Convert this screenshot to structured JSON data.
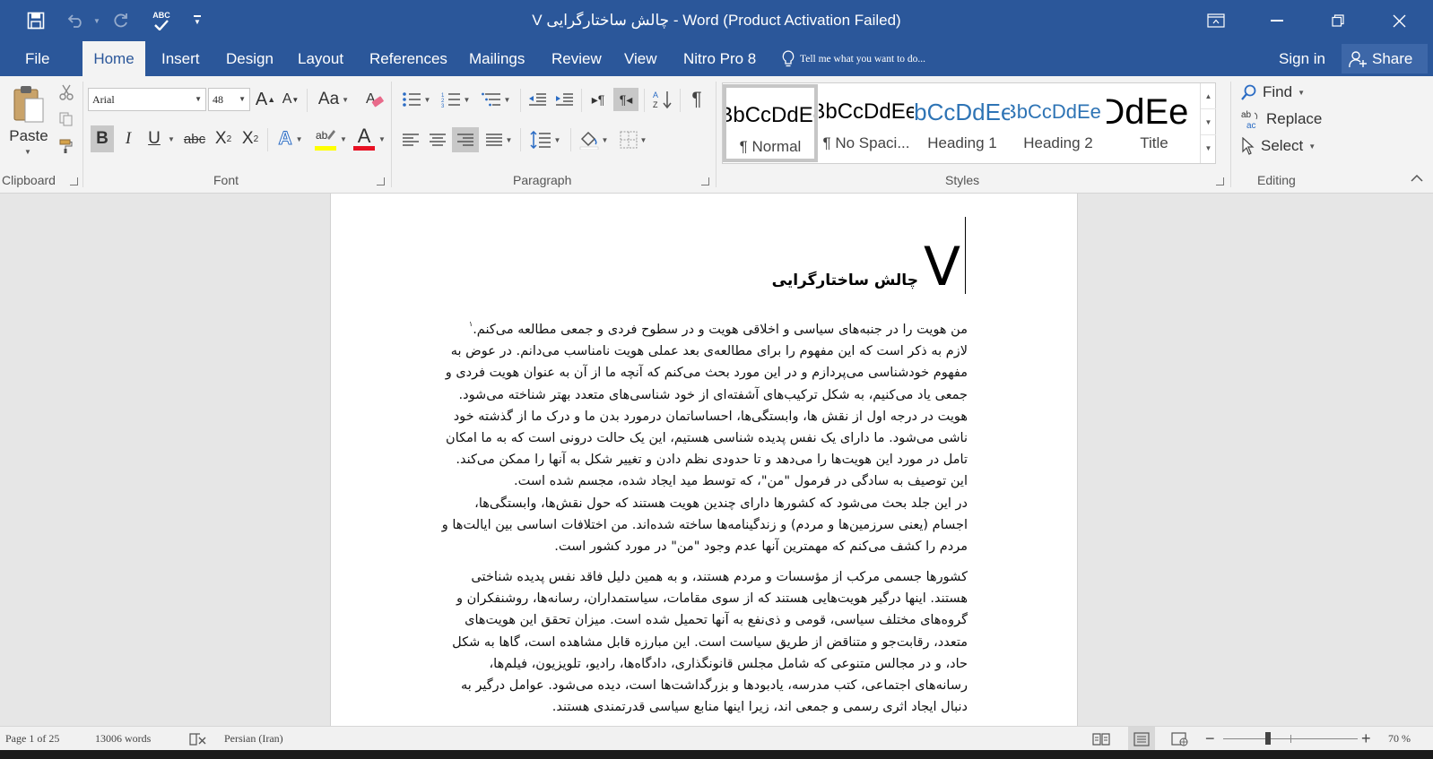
{
  "window": {
    "title": "V چالش ساختارگرایی - Word (Product Activation Failed)",
    "accent_color": "#2b579a"
  },
  "quick_access": {
    "icons": [
      "save-icon",
      "undo-icon",
      "redo-icon",
      "spelling-check-icon",
      "customize-toolbar-icon"
    ],
    "spelling_label": "ABC"
  },
  "tabs": [
    {
      "label": "File"
    },
    {
      "label": "Home",
      "active": true
    },
    {
      "label": "Insert"
    },
    {
      "label": "Design"
    },
    {
      "label": "Layout"
    },
    {
      "label": "References"
    },
    {
      "label": "Mailings"
    },
    {
      "label": "Review"
    },
    {
      "label": "View"
    },
    {
      "label": "Nitro Pro 8"
    }
  ],
  "tell_me": "Tell me what you want to do...",
  "account": {
    "sign_in": "Sign in",
    "share": "Share"
  },
  "ribbon": {
    "clipboard": {
      "label": "Clipboard",
      "paste": "Paste"
    },
    "font": {
      "label": "Font",
      "font_name": "Arial",
      "font_size": "48",
      "change_case": "Aa",
      "bold": "B",
      "italic": "I",
      "underline": "U",
      "strikethrough": "abc",
      "subscript": "X",
      "subscript_mark": "2",
      "superscript": "X",
      "superscript_mark": "2",
      "text_effects": "A",
      "font_color": "A",
      "font_color_value": "#e81123",
      "highlight_color_value": "#ffff00",
      "grow_font": "A",
      "shrink_font": "A"
    },
    "paragraph": {
      "label": "Paragraph"
    },
    "styles": {
      "label": "Styles",
      "items": [
        {
          "preview": "AaBbCcDdEe",
          "name": "¶ Normal",
          "selected": true
        },
        {
          "preview": "AaBbCcDdEe",
          "name": "¶ No Spaci..."
        },
        {
          "preview": "AaBbCcDdEe",
          "name": "Heading 1"
        },
        {
          "preview": "AaBbCcDdEe",
          "name": "Heading 2"
        },
        {
          "preview": "AaBbCcDdEe",
          "name": "Title"
        }
      ]
    },
    "editing": {
      "label": "Editing",
      "find": "Find",
      "replace": "Replace",
      "select": "Select"
    }
  },
  "document": {
    "heading_number": "V",
    "heading_text": "چالش ساختارگرایی",
    "paragraph1": [
      "من هویت را در جنبه‌های سیاسی و اخلاقی هویت و در سطوح فردی و جمعی مطالعه می‌کنم.",
      "لازم به ذکر است که این مفهوم را برای مطالعه‌ی بعد عملی هویت نامناسب می‌دانم. در عوض به",
      "مفهوم خودشناسی می‌پردازم و در این مورد بحث می‌کنم که آنچه ما از آن به عنوان هویت فردی و",
      "جمعی یاد می‌کنیم، به شکل ترکیب‌های آشفته‌ای از خود شناسی‌های متعدد بهتر شناخته می‌شود.",
      "هویت در درجه اول از نقش ها، وابستگی‌ها، احساساتمان درمورد بدن ما و درک ما از گذشته خود",
      "ناشی می‌شود. ما دارای یک نفس پدیده شناسی هستیم، این یک حالت درونی است که به ما امکان",
      "تامل در مورد این هویت‌ها را می‌دهد و تا حدودی نظم دادن و تغییر شکل به آنها را ممکن می‌کند.",
      "این توصیف به سادگی در فرمول \"من\"، که توسط مید ایجاد شده، مجسم شده است.",
      "در این جلد بحث می‌شود که کشورها دارای چندین هویت هستند که حول نقش‌ها، وابستگی‌ها،",
      "اجسام (یعنی سرزمین‌ها و مردم) و زندگینامه‌ها ساخته شده‌اند. من اختلافات اساسی بین ایالت‌ها و",
      "مردم را کشف می‌کنم که مهمترین آنها عدم وجود \"من\" در مورد کشور است."
    ],
    "footnote_marker": "۱",
    "paragraph2": [
      "کشورها جسمی مرکب از مؤسسات و مردم هستند، و به همین دلیل فاقد نفس پدیده شناختی",
      "هستند. اینها درگیر هویت‌هایی هستند که از سوی مقامات، سیاستمداران، رسانه‌ها، روشنفکران و",
      "گروه‌های مختلف سیاسی، قومی و ذی‌نفع به آنها تحمیل شده است. میزان تحقق این هویت‌های",
      "متعدد، رقابت‌جو و متناقض از طریق سیاست است. این مبارزه قابل مشاهده است، گاها به شکل",
      "حاد، و در مجالس متنوعی که شامل مجلس قانونگذاری، دادگاه‌ها، رادیو، تلویزیون، فیلم‌ها،",
      "رسانه‌های اجتماعی، کتب مدرسه، یادبودها و بزرگداشت‌ها است، دیده می‌شود. عوامل درگیر به",
      "دنبال ایجاد اثری رسمی و جمعی اند، زیرا اینها منابع سیاسی قدرتمندی هستند."
    ]
  },
  "status": {
    "page": "Page 1 of 25",
    "words": "13006 words",
    "language": "Persian (Iran)",
    "zoom": "70 %",
    "zoom_level": 0.7
  }
}
